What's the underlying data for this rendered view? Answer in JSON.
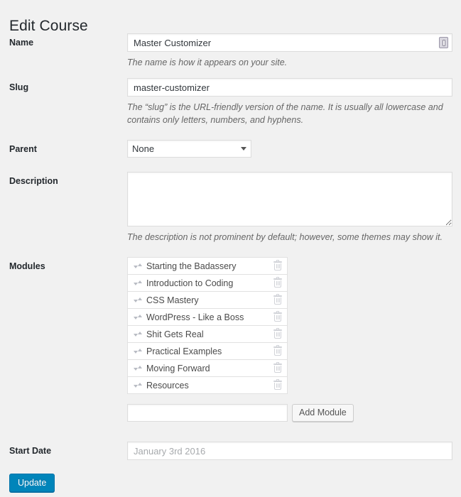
{
  "page": {
    "title": "Edit Course",
    "background_color": "#f1f1f1",
    "accent_color": "#0085ba"
  },
  "fields": {
    "name": {
      "label": "Name",
      "value": "Master Customizer",
      "placeholder": "",
      "help": "The name is how it appears on your site."
    },
    "slug": {
      "label": "Slug",
      "value": "master-customizer",
      "placeholder": "",
      "help": "The “slug” is the URL-friendly version of the name. It is usually all lowercase and contains only letters, numbers, and hyphens."
    },
    "parent": {
      "label": "Parent",
      "selected": "None",
      "options": [
        "None"
      ]
    },
    "description": {
      "label": "Description",
      "value": "",
      "placeholder": "",
      "help": "The description is not prominent by default; however, some themes may show it."
    },
    "modules": {
      "label": "Modules",
      "items": [
        {
          "name": "Starting the Badassery"
        },
        {
          "name": "Introduction to Coding"
        },
        {
          "name": "CSS Mastery"
        },
        {
          "name": "WordPress - Like a Boss"
        },
        {
          "name": "Shit Gets Real"
        },
        {
          "name": "Practical Examples"
        },
        {
          "name": "Moving Forward"
        },
        {
          "name": "Resources"
        }
      ],
      "add_input_value": "",
      "add_input_placeholder": "",
      "add_button_label": "Add Module"
    },
    "start_date": {
      "label": "Start Date",
      "value": "",
      "placeholder": "January 3rd 2016"
    }
  },
  "submit": {
    "update_label": "Update"
  },
  "icons": {
    "autofill": "form-autofill-icon",
    "sort_handle": "sort-handle-icon",
    "delete": "trash-icon",
    "select_arrow": "chevron-down-icon"
  }
}
